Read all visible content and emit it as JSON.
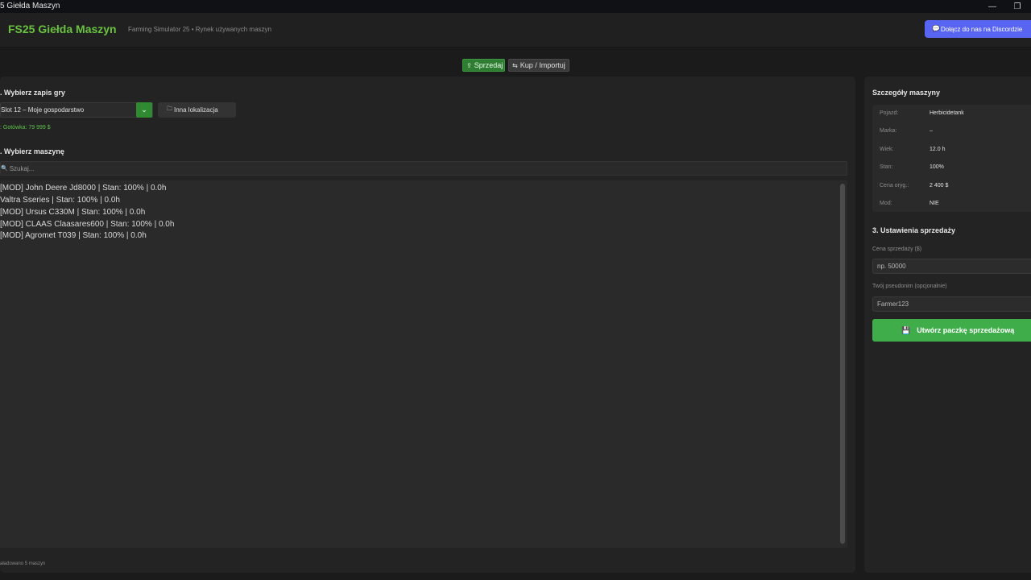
{
  "window": {
    "title": "5 Giełda Maszyn",
    "controls": {
      "minimize": "—",
      "restore": "❐"
    }
  },
  "header": {
    "brand": "FS25 Giełda Maszyn",
    "subtitle": "Farming Simulator 25 • Rynek używanych maszyn",
    "discord_label": "Dołącz do nas na Discordzie",
    "discord_icon": "💬"
  },
  "tabs": [
    {
      "label": "Sprzedaj",
      "icon": "⇪",
      "active": true
    },
    {
      "label": "Kup / Importuj",
      "icon": "⇆",
      "active": false
    }
  ],
  "left": {
    "section1_title": ". Wybierz zapis gry",
    "save_select_value": "Slot 12 – Moje gospodarstwo",
    "chevron": "⌄",
    "other_location_label": "Inna lokalizacja",
    "other_location_icon": "🗀",
    "cash": ": Gotówka: 79 999 $",
    "section2_title": ". Wybierz maszynę",
    "search_placeholder": "Szukaj...",
    "search_icon": "🔍",
    "machines": [
      "[MOD] John Deere Jd8000  |  Stan: 100%  |  0.0h",
      "Valtra Sseries  |  Stan: 100%  |  0.0h",
      "[MOD] Ursus C330M  |  Stan: 100%  |  0.0h",
      "[MOD] CLAAS Claasares600  |  Stan: 100%  |  0.0h",
      "[MOD] Agromet T039  |  Stan: 100%  |  0.0h"
    ],
    "loaded_status": "aładowano 5 maszyn"
  },
  "right": {
    "details_title": "Szczegóły maszyny",
    "details": [
      {
        "label": "Pojazd:",
        "value": "Herbicidetank"
      },
      {
        "label": "Marka:",
        "value": "–"
      },
      {
        "label": "Wiek:",
        "value": "12.0 h"
      },
      {
        "label": "Stan:",
        "value": "100%"
      },
      {
        "label": "Cena oryg.:",
        "value": "2 400 $"
      },
      {
        "label": "Mod:",
        "value": "NIE"
      }
    ],
    "section3_title": "3. Ustawienia sprzedaży",
    "price_label": "Cena sprzedaży ($)",
    "price_placeholder": "np. 50000",
    "nick_label": "Twój pseudonim (opcjonalnie)",
    "nick_placeholder": "Farmer123",
    "create_button": "Utwórz paczkę sprzedażową",
    "create_icon": "💾"
  },
  "colors": {
    "accent_green": "#69c23e",
    "button_green": "#3fae4a",
    "discord_blue": "#5865f2",
    "background": "#1b1b1b"
  }
}
